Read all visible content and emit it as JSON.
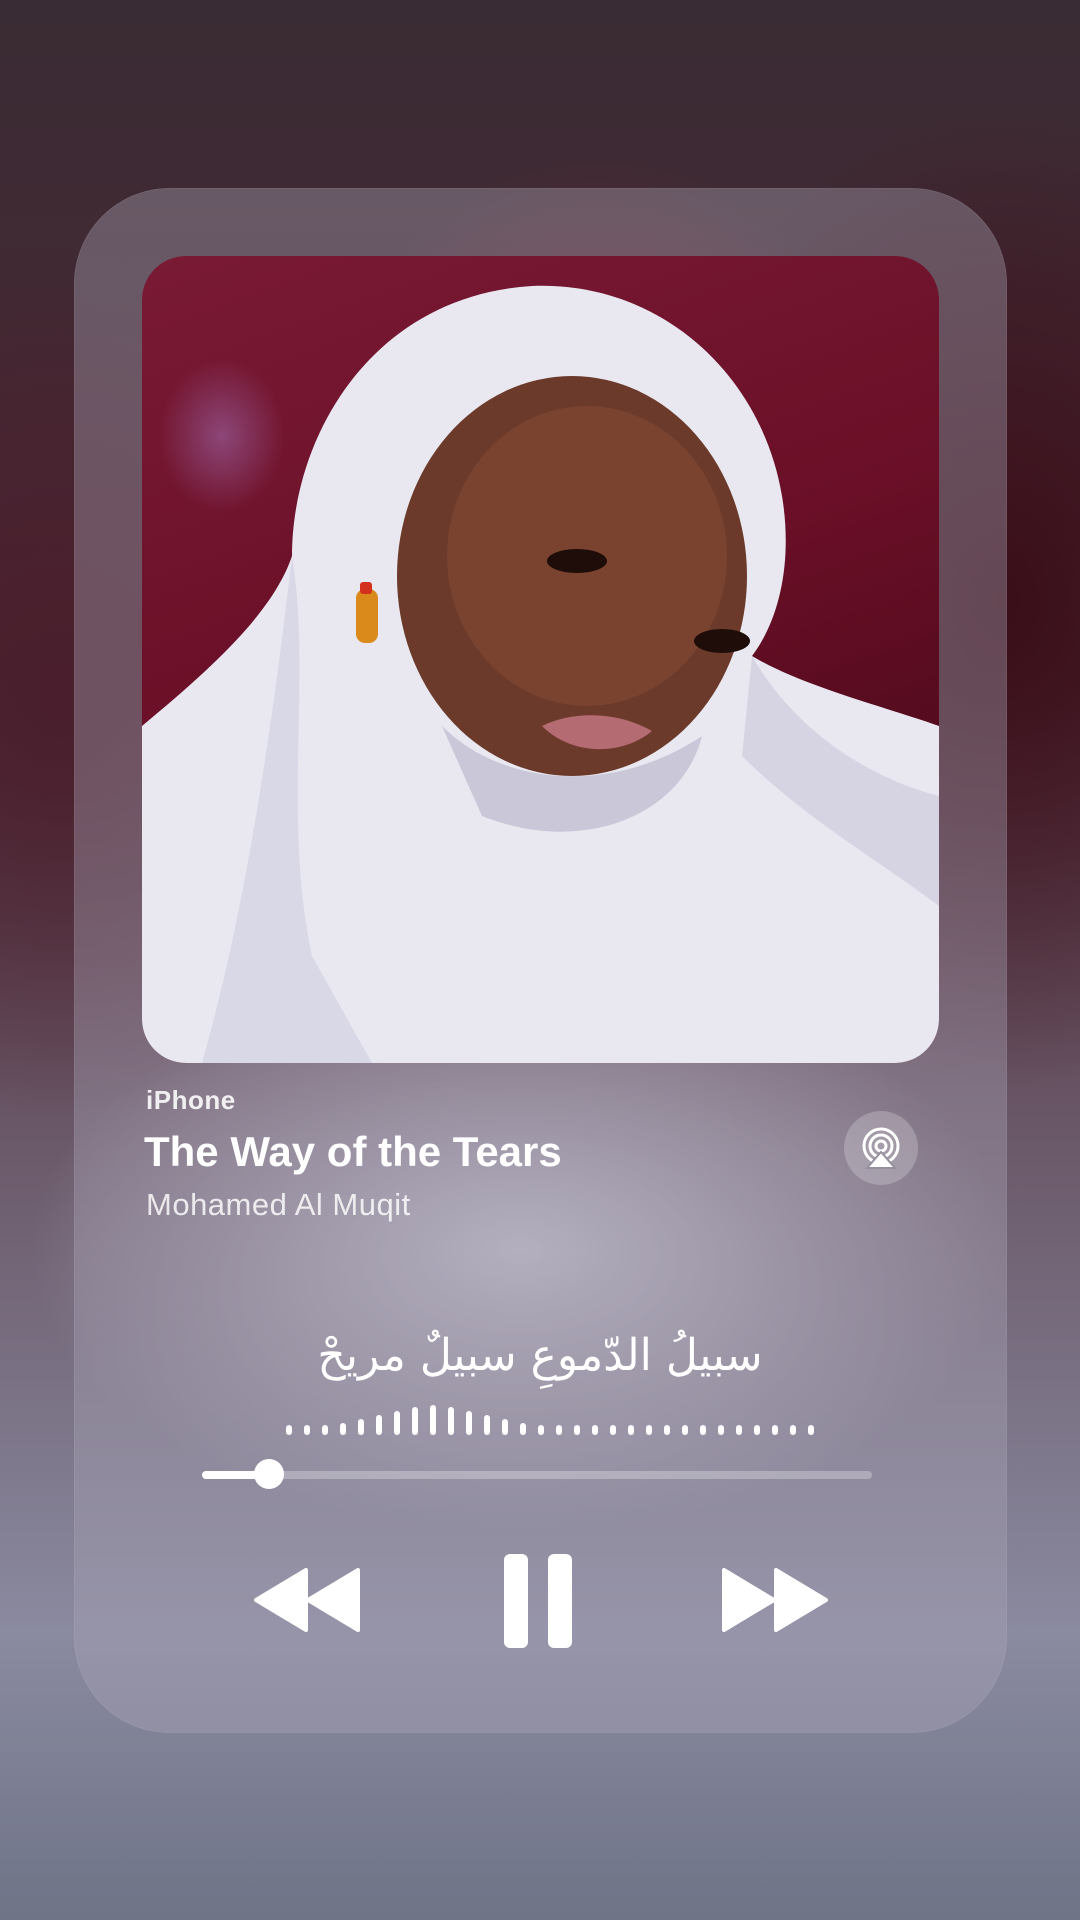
{
  "player": {
    "source": "iPhone",
    "title": "The Way of the Tears",
    "artist": "Mohamed Al Muqit",
    "lyric": "سبيلُ الدّموعِ سبيلٌ مريحْ",
    "progress": 0.1
  },
  "icons": {
    "airplay": "airplay-audio-icon",
    "rewind": "rewind-icon",
    "pause": "pause-icon",
    "forward": "fast-forward-icon"
  },
  "colors": {
    "text": "#ffffff",
    "card": "rgba(170,165,185,0.38)"
  }
}
